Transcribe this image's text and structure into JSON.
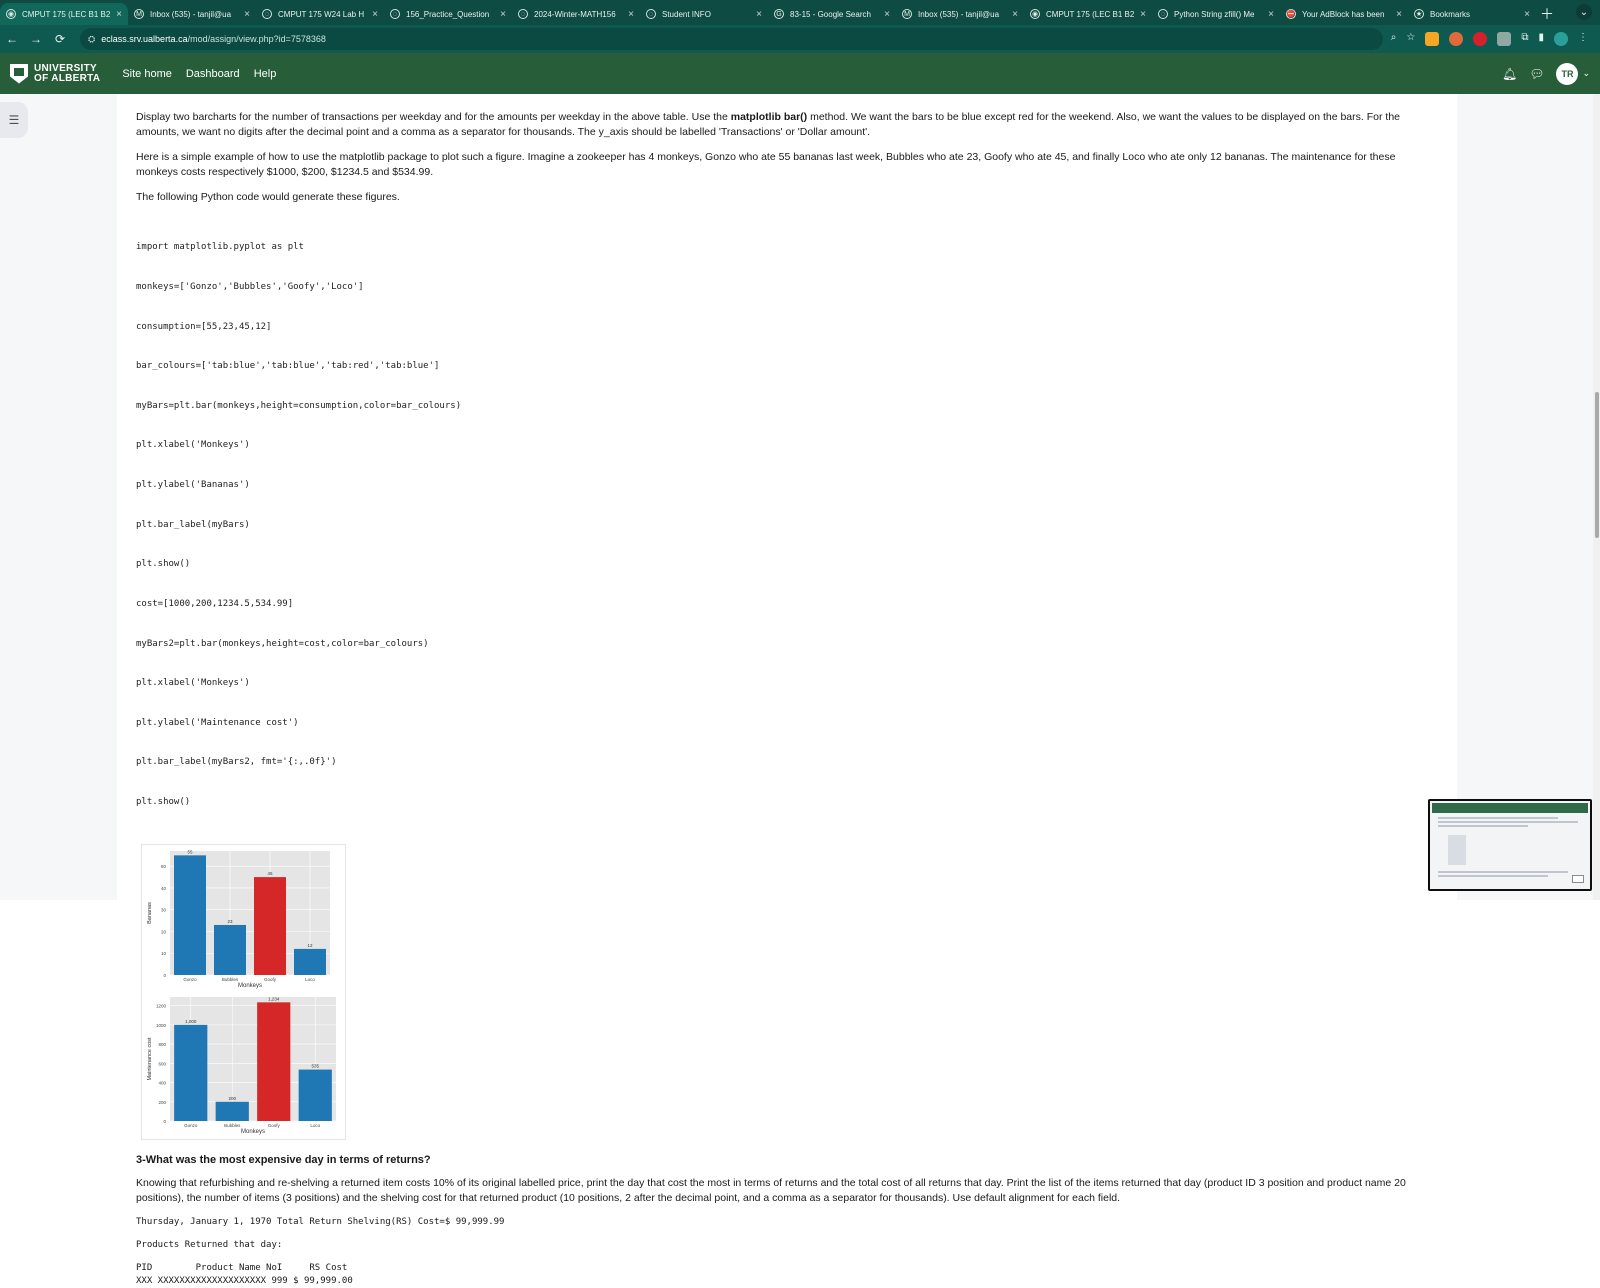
{
  "browser": {
    "tabs": [
      {
        "title": "CMPUT 175 (LEC B1 B2",
        "active": true,
        "icon": "moodle-icon"
      },
      {
        "title": "Inbox (535) - tanjil@ua",
        "active": false,
        "icon": "gmail-icon"
      },
      {
        "title": "CMPUT 175 W24 Lab H",
        "active": false,
        "icon": "globe-icon"
      },
      {
        "title": "156_Practice_Question",
        "active": false,
        "icon": "globe-icon"
      },
      {
        "title": "2024-Winter-MATH156",
        "active": false,
        "icon": "globe-icon"
      },
      {
        "title": "Student INFO",
        "active": false,
        "icon": "globe-icon"
      },
      {
        "title": "83-15 - Google Search",
        "active": false,
        "icon": "google-icon"
      },
      {
        "title": "Inbox (535) - tanjil@ua",
        "active": false,
        "icon": "gmail-icon"
      },
      {
        "title": "CMPUT 175 (LEC B1 B2",
        "active": false,
        "icon": "moodle-icon"
      },
      {
        "title": "Python String zfill() Me",
        "active": false,
        "icon": "globe-icon"
      },
      {
        "title": "Your AdBlock has been",
        "active": false,
        "icon": "adblock-icon"
      },
      {
        "title": "Bookmarks",
        "active": false,
        "icon": "star-icon"
      }
    ],
    "address": {
      "host": "eclass.srv.ualberta.ca",
      "path": "/mod/assign/view.php?id=7578368"
    }
  },
  "header": {
    "logo_line1": "UNIVERSITY",
    "logo_line2": "OF ALBERTA",
    "nav": [
      "Site home",
      "Dashboard",
      "Help"
    ],
    "avatar_initials": "TR"
  },
  "content": {
    "para1_before_bold": "Display two barcharts for the number of transactions per weekday and for the amounts per weekday in the above table. Use the ",
    "para1_bold": "matplotlib bar()",
    "para1_after_bold": " method. We want the bars to be blue except red for the weekend. Also, we want the values to be displayed on the bars. For the amounts, we want no digits after the decimal point and a comma as a separator for thousands. The y_axis should be labelled 'Transactions' or 'Dollar amount'.",
    "para2": "Here is a simple example of how to use the matplotlib package to plot such a figure. Imagine a zookeeper has 4 monkeys, Gonzo who ate 55 bananas last week, Bubbles who ate 23, Goofy who ate 45, and finally Loco who ate only 12 bananas. The maintenance for these monkeys costs respectively $1000, $200, $1234.5 and $534.99.",
    "para3": "The following Python code would generate these figures.",
    "code": [
      "import matplotlib.pyplot as plt",
      "monkeys=['Gonzo','Bubbles','Goofy','Loco']",
      "consumption=[55,23,45,12]",
      "bar_colours=['tab:blue','tab:blue','tab:red','tab:blue']",
      "myBars=plt.bar(monkeys,height=consumption,color=bar_colours)",
      "plt.xlabel('Monkeys')",
      "plt.ylabel('Bananas')",
      "plt.bar_label(myBars)",
      "plt.show()",
      "cost=[1000,200,1234.5,534.99]",
      "myBars2=plt.bar(monkeys,height=cost,color=bar_colours)",
      "plt.xlabel('Monkeys')",
      "plt.ylabel('Maintenance cost')",
      "plt.bar_label(myBars2, fmt='{:,.0f}')",
      "plt.show()"
    ],
    "section3_title": "3-What was the most expensive day in terms of returns?",
    "section3_text": "Knowing that refurbishing and re-shelving a returned item costs 10% of its original labelled price, print the day that cost the most in terms of returns and the total cost of all returns that day. Print the list of the items returned that day (product ID 3 position and product name 20 positions), the number of items (3 positions) and the shelving cost for that returned product (10 positions, 2 after the decimal point, and a comma as a separator for thousands). Use default alignment for each field.",
    "output_line1": "Thursday, January 1, 1970 Total Return Shelving(RS) Cost=$ 99,999.99",
    "output_line2": "Products Returned that day:",
    "output_header": "PID        Product Name NoI     RS Cost",
    "output_row": "XXX XXXXXXXXXXXXXXXXXXXX 999 $ 99,999.00"
  },
  "chart_data": [
    {
      "type": "bar",
      "categories": [
        "Gonzo",
        "Bubbles",
        "Goofy",
        "Loco"
      ],
      "values": [
        55,
        23,
        45,
        12
      ],
      "labels": [
        "55",
        "23",
        "45",
        "12"
      ],
      "colors": [
        "#1f77b4",
        "#1f77b4",
        "#d62728",
        "#1f77b4"
      ],
      "xlabel": "Monkeys",
      "ylabel": "Bananas",
      "yticks": [
        0,
        10,
        20,
        30,
        40,
        50
      ],
      "ylim": [
        0,
        57
      ]
    },
    {
      "type": "bar",
      "categories": [
        "Gonzo",
        "Bubbles",
        "Goofy",
        "Loco"
      ],
      "values": [
        1000,
        200,
        1234.5,
        534.99
      ],
      "labels": [
        "1,000",
        "200",
        "1,234",
        "535"
      ],
      "colors": [
        "#1f77b4",
        "#1f77b4",
        "#d62728",
        "#1f77b4"
      ],
      "xlabel": "Monkeys",
      "ylabel": "Maintenance cost",
      "yticks": [
        0,
        200,
        400,
        600,
        800,
        1000,
        1200
      ],
      "ylim": [
        0,
        1290
      ]
    }
  ]
}
